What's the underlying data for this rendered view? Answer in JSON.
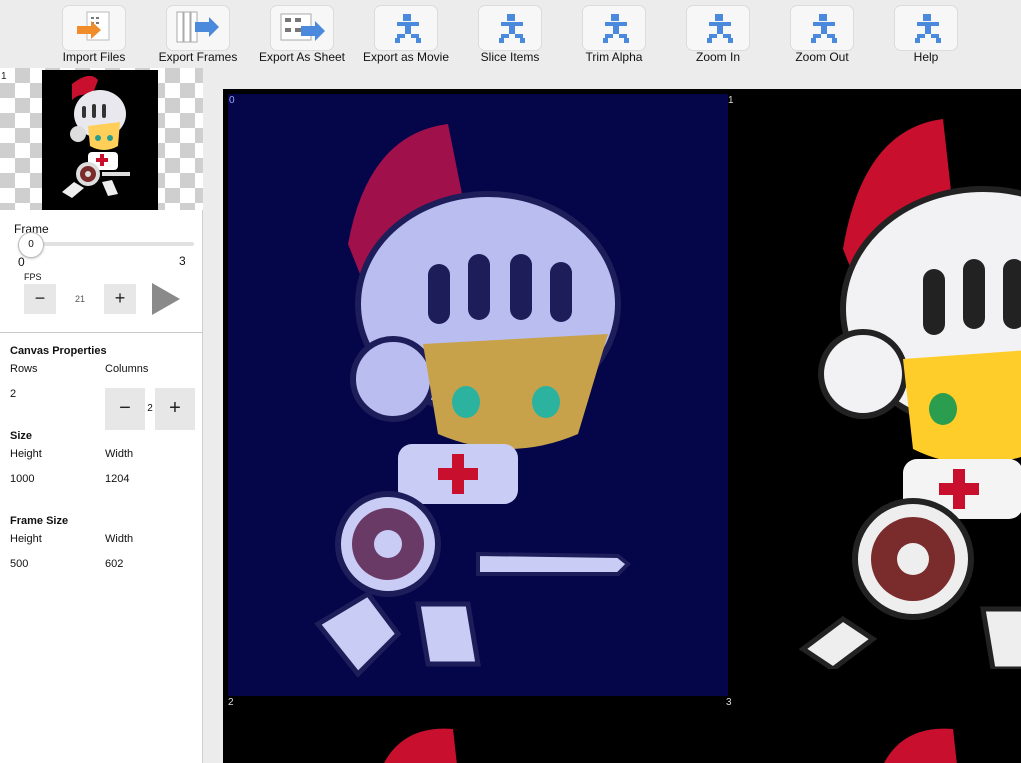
{
  "toolbar": {
    "items": [
      {
        "label": "Import Files",
        "icon": "import-files-icon"
      },
      {
        "label": "Export Frames",
        "icon": "export-frames-icon"
      },
      {
        "label": "Export As Sheet",
        "icon": "export-sheet-icon"
      },
      {
        "label": "Export as Movie",
        "icon": "export-movie-icon"
      },
      {
        "label": "Slice Items",
        "icon": "slice-items-icon"
      },
      {
        "label": "Trim Alpha",
        "icon": "trim-alpha-icon"
      },
      {
        "label": "Zoom In",
        "icon": "zoom-in-icon"
      },
      {
        "label": "Zoom Out",
        "icon": "zoom-out-icon"
      },
      {
        "label": "Help",
        "icon": "help-icon"
      }
    ]
  },
  "thumbnails": {
    "index_label": "1"
  },
  "playback": {
    "frame_label": "Frame",
    "frame_value": "0",
    "frame_min": "0",
    "frame_max": "3",
    "fps_label": "FPS",
    "fps_value": "21",
    "minus": "−",
    "plus": "+"
  },
  "canvas_properties": {
    "title": "Canvas Properties",
    "rows_label": "Rows",
    "columns_label": "Columns",
    "rows_value": "2",
    "columns_value": "2",
    "minus": "−",
    "plus": "+"
  },
  "size": {
    "title": "Size",
    "height_label": "Height",
    "width_label": "Width",
    "height_value": "1000",
    "width_value": "1204"
  },
  "frame_size": {
    "title": "Frame Size",
    "height_label": "Height",
    "width_label": "Width",
    "height_value": "500",
    "width_value": "602"
  },
  "canvas": {
    "cell_labels": [
      "0",
      "1",
      "2",
      "3"
    ]
  },
  "colors": {
    "frame0_background": "#05054a",
    "canvas_background": "#000000",
    "icon_blue": "#4a89dc",
    "icon_orange": "#f08c2a"
  }
}
